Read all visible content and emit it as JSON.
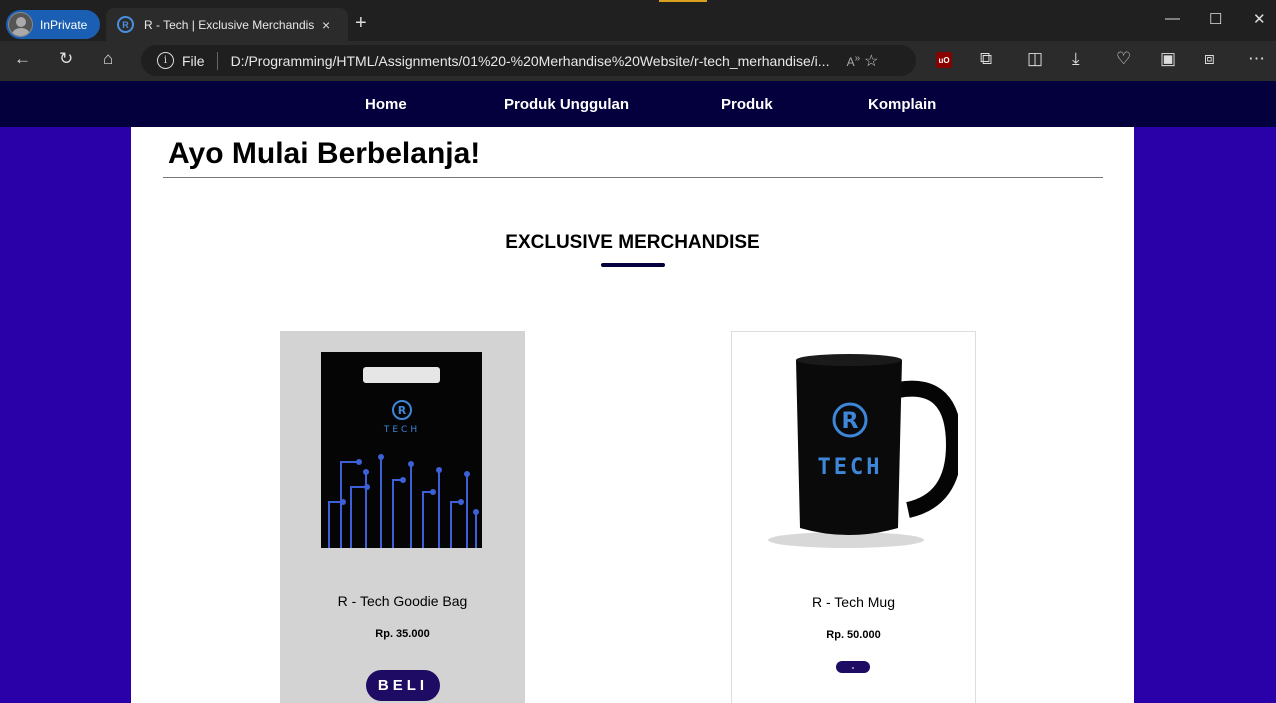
{
  "browser": {
    "inprivate_label": "InPrivate",
    "tab_title": "R - Tech | Exclusive Merchandise",
    "tab_close": "×",
    "new_tab": "+",
    "address": {
      "scheme_label": "File",
      "url": "D:/Programming/HTML/Assignments/01%20-%20Merhandise%20Website/r-tech_merhandise/i..."
    },
    "window_controls": [
      "—",
      "☐",
      "✕"
    ]
  },
  "nav": {
    "items": [
      {
        "label": "Home"
      },
      {
        "label": "Produk Unggulan"
      },
      {
        "label": "Produk"
      },
      {
        "label": "Komplain"
      }
    ]
  },
  "page": {
    "heading": "Ayo Mulai Berbelanja!",
    "section_title": "EXCLUSIVE MERCHANDISE",
    "products": [
      {
        "name": "R - Tech Goodie Bag",
        "price": "Rp. 35.000",
        "button": "BELI",
        "image_text": "TECH"
      },
      {
        "name": "R - Tech Mug",
        "price": "Rp. 50.000",
        "button": "-",
        "image_text": "TECH"
      }
    ]
  },
  "colors": {
    "page_background": "#2a00a8",
    "nav_background": "#03003d",
    "button_background": "#1e0b63",
    "brand_blue": "#3d86d8"
  }
}
